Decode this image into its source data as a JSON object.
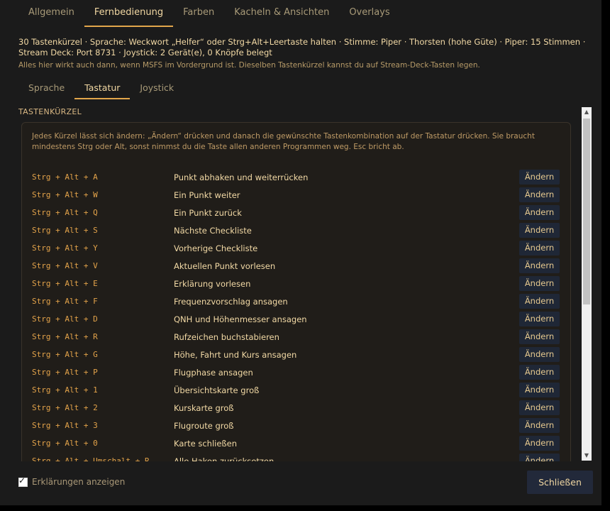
{
  "top_tabs": [
    "Allgemein",
    "Fernbedienung",
    "Farben",
    "Kacheln & Ansichten",
    "Overlays"
  ],
  "active_top_tab": 1,
  "summary": "30 Tastenkürzel · Sprache: Weckwort „Helfer“ oder Strg+Alt+Leertaste halten · Stimme: Piper · Thorsten (hohe Güte) · Piper: 15 Stimmen · Stream Deck: Port 8731 · Joystick: 2 Gerät(e), 0 Knöpfe belegt",
  "hint": "Alles hier wirkt auch dann, wenn MSFS im Vordergrund ist. Dieselben Tastenkürzel kannst du auf Stream-Deck-Tasten legen.",
  "sub_tabs": [
    "Sprache",
    "Tastatur",
    "Joystick"
  ],
  "active_sub_tab": 1,
  "section_title": "TASTENKÜRZEL",
  "card_description": "Jedes Kürzel lässt sich ändern: „Ändern“ drücken und danach die gewünschte Tastenkombination auf der Tastatur drücken. Sie braucht mindestens Strg oder Alt, sonst nimmst du die Taste allen anderen Programmen weg. Esc bricht ab.",
  "change_label": "Ändern",
  "shortcuts": [
    {
      "combo": "Strg + Alt + A",
      "action": "Punkt abhaken und weiterrücken"
    },
    {
      "combo": "Strg + Alt + W",
      "action": "Ein Punkt weiter"
    },
    {
      "combo": "Strg + Alt + Q",
      "action": "Ein Punkt zurück"
    },
    {
      "combo": "Strg + Alt + S",
      "action": "Nächste Checkliste"
    },
    {
      "combo": "Strg + Alt + Y",
      "action": "Vorherige Checkliste"
    },
    {
      "combo": "Strg + Alt + V",
      "action": "Aktuellen Punkt vorlesen"
    },
    {
      "combo": "Strg + Alt + E",
      "action": "Erklärung vorlesen"
    },
    {
      "combo": "Strg + Alt + F",
      "action": "Frequenzvorschlag ansagen"
    },
    {
      "combo": "Strg + Alt + D",
      "action": "QNH und Höhenmesser ansagen"
    },
    {
      "combo": "Strg + Alt + R",
      "action": "Rufzeichen buchstabieren"
    },
    {
      "combo": "Strg + Alt + G",
      "action": "Höhe, Fahrt und Kurs ansagen"
    },
    {
      "combo": "Strg + Alt + P",
      "action": "Flugphase ansagen"
    },
    {
      "combo": "Strg + Alt + 1",
      "action": "Übersichtskarte groß"
    },
    {
      "combo": "Strg + Alt + 2",
      "action": "Kurskarte groß"
    },
    {
      "combo": "Strg + Alt + 3",
      "action": "Flugroute groß"
    },
    {
      "combo": "Strg + Alt + 0",
      "action": "Karte schließen"
    },
    {
      "combo": "Strg + Alt + Umschalt + R",
      "action": "Alle Haken zurücksetzen"
    }
  ],
  "show_explanations_label": "Erklärungen anzeigen",
  "show_explanations_checked": true,
  "close_label": "Schließen",
  "colors": {
    "accent": "#e2a64b",
    "background": "#1b1b1b",
    "button": "#1f2736"
  }
}
